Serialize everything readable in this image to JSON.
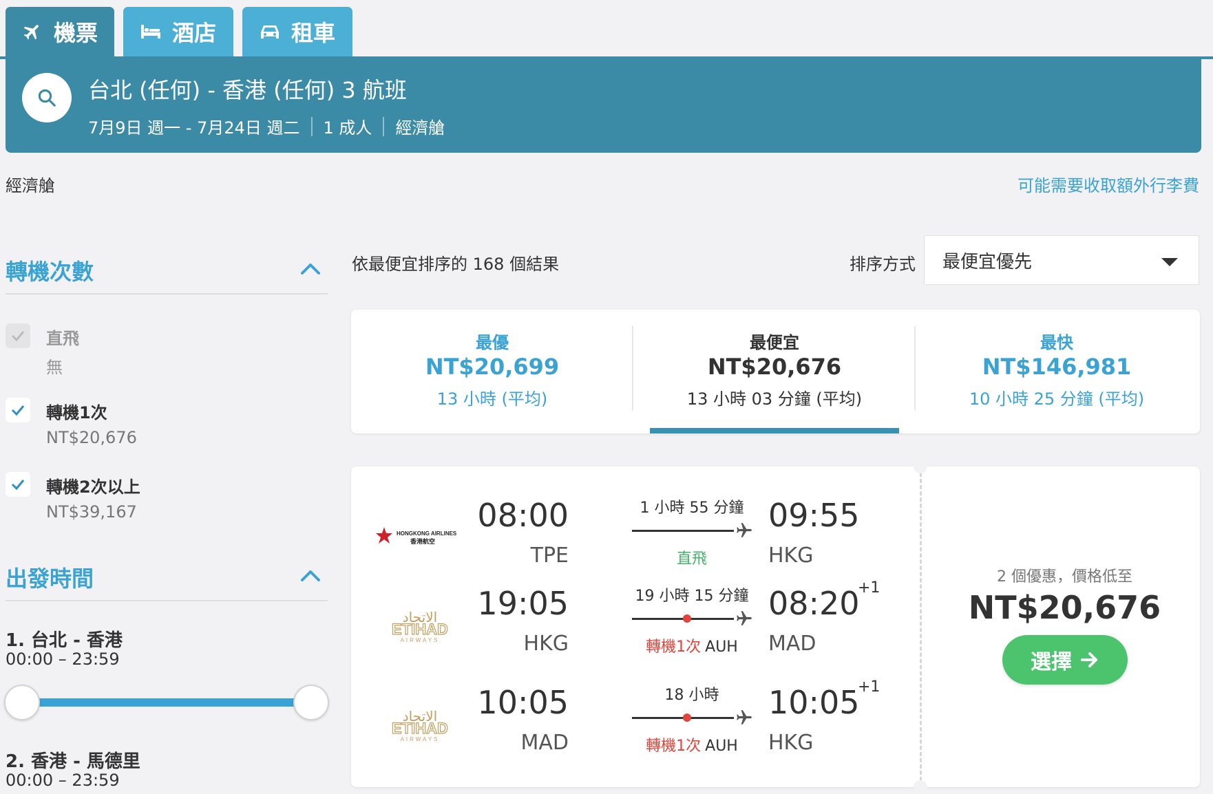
{
  "tabs": [
    {
      "label": "機票",
      "icon": "plane-icon"
    },
    {
      "label": "酒店",
      "icon": "bed-icon"
    },
    {
      "label": "租車",
      "icon": "car-icon"
    }
  ],
  "search": {
    "title": "台北 (任何) - 香港 (任何) 3 航班",
    "dates": "7月9日 週一 - 7月24日 週二",
    "passengers": "1 成人",
    "cabin": "經濟艙"
  },
  "cabin_label": "經濟艙",
  "baggage_link": "可能需要收取額外行李費",
  "sidebar": {
    "stops": {
      "title": "轉機次數",
      "options": [
        {
          "label": "直飛",
          "price": "無",
          "checked": true,
          "disabled": true
        },
        {
          "label": "轉機1次",
          "price": "NT$20,676",
          "checked": true,
          "disabled": false
        },
        {
          "label": "轉機2次以上",
          "price": "NT$39,167",
          "checked": true,
          "disabled": false
        }
      ]
    },
    "departure": {
      "title": "出發時間",
      "routes": [
        {
          "name": "1. 台北 - 香港",
          "range": "00:00 – 23:59"
        },
        {
          "name": "2. 香港 - 馬德里",
          "range": "00:00 – 23:59"
        }
      ]
    }
  },
  "results": {
    "count_text": "依最便宜排序的 168 個結果",
    "sort_label": "排序方式",
    "sort_value": "最便宜優先"
  },
  "summary": [
    {
      "label": "最優",
      "price": "NT$20,699",
      "duration": "13 小時 (平均)",
      "active": false
    },
    {
      "label": "最便宜",
      "price": "NT$20,676",
      "duration": "13 小時 03 分鐘 (平均)",
      "active": true
    },
    {
      "label": "最快",
      "price": "NT$146,981",
      "duration": "10 小時 25 分鐘 (平均)",
      "active": false
    }
  ],
  "result": {
    "legs": [
      {
        "airline": "HONGKONG AIRLINES 香港航空",
        "dep_time": "08:00",
        "dep_code": "TPE",
        "arr_time": "09:55",
        "arr_code": "HKG",
        "plus": "",
        "duration": "1 小時 55 分鐘",
        "stops_label": "直飛",
        "stop_code": ""
      },
      {
        "airline": "ETIHAD AIRWAYS",
        "dep_time": "19:05",
        "dep_code": "HKG",
        "arr_time": "08:20",
        "arr_code": "MAD",
        "plus": "+1",
        "duration": "19 小時 15 分鐘",
        "stops_label": "轉機1次",
        "stop_code": "AUH"
      },
      {
        "airline": "ETIHAD AIRWAYS",
        "dep_time": "10:05",
        "dep_code": "MAD",
        "arr_time": "10:05",
        "arr_code": "HKG",
        "plus": "+1",
        "duration": "18 小時",
        "stops_label": "轉機1次",
        "stop_code": "AUH"
      }
    ],
    "deals_text": "2 個優惠，價格低至",
    "price": "NT$20,676",
    "select_label": "選擇"
  },
  "colors": {
    "primary": "#3b8aa6",
    "accent": "#3aa3d3",
    "tab_inactive": "#4cb0d6",
    "green": "#4cc46e",
    "red": "#e0443a"
  }
}
